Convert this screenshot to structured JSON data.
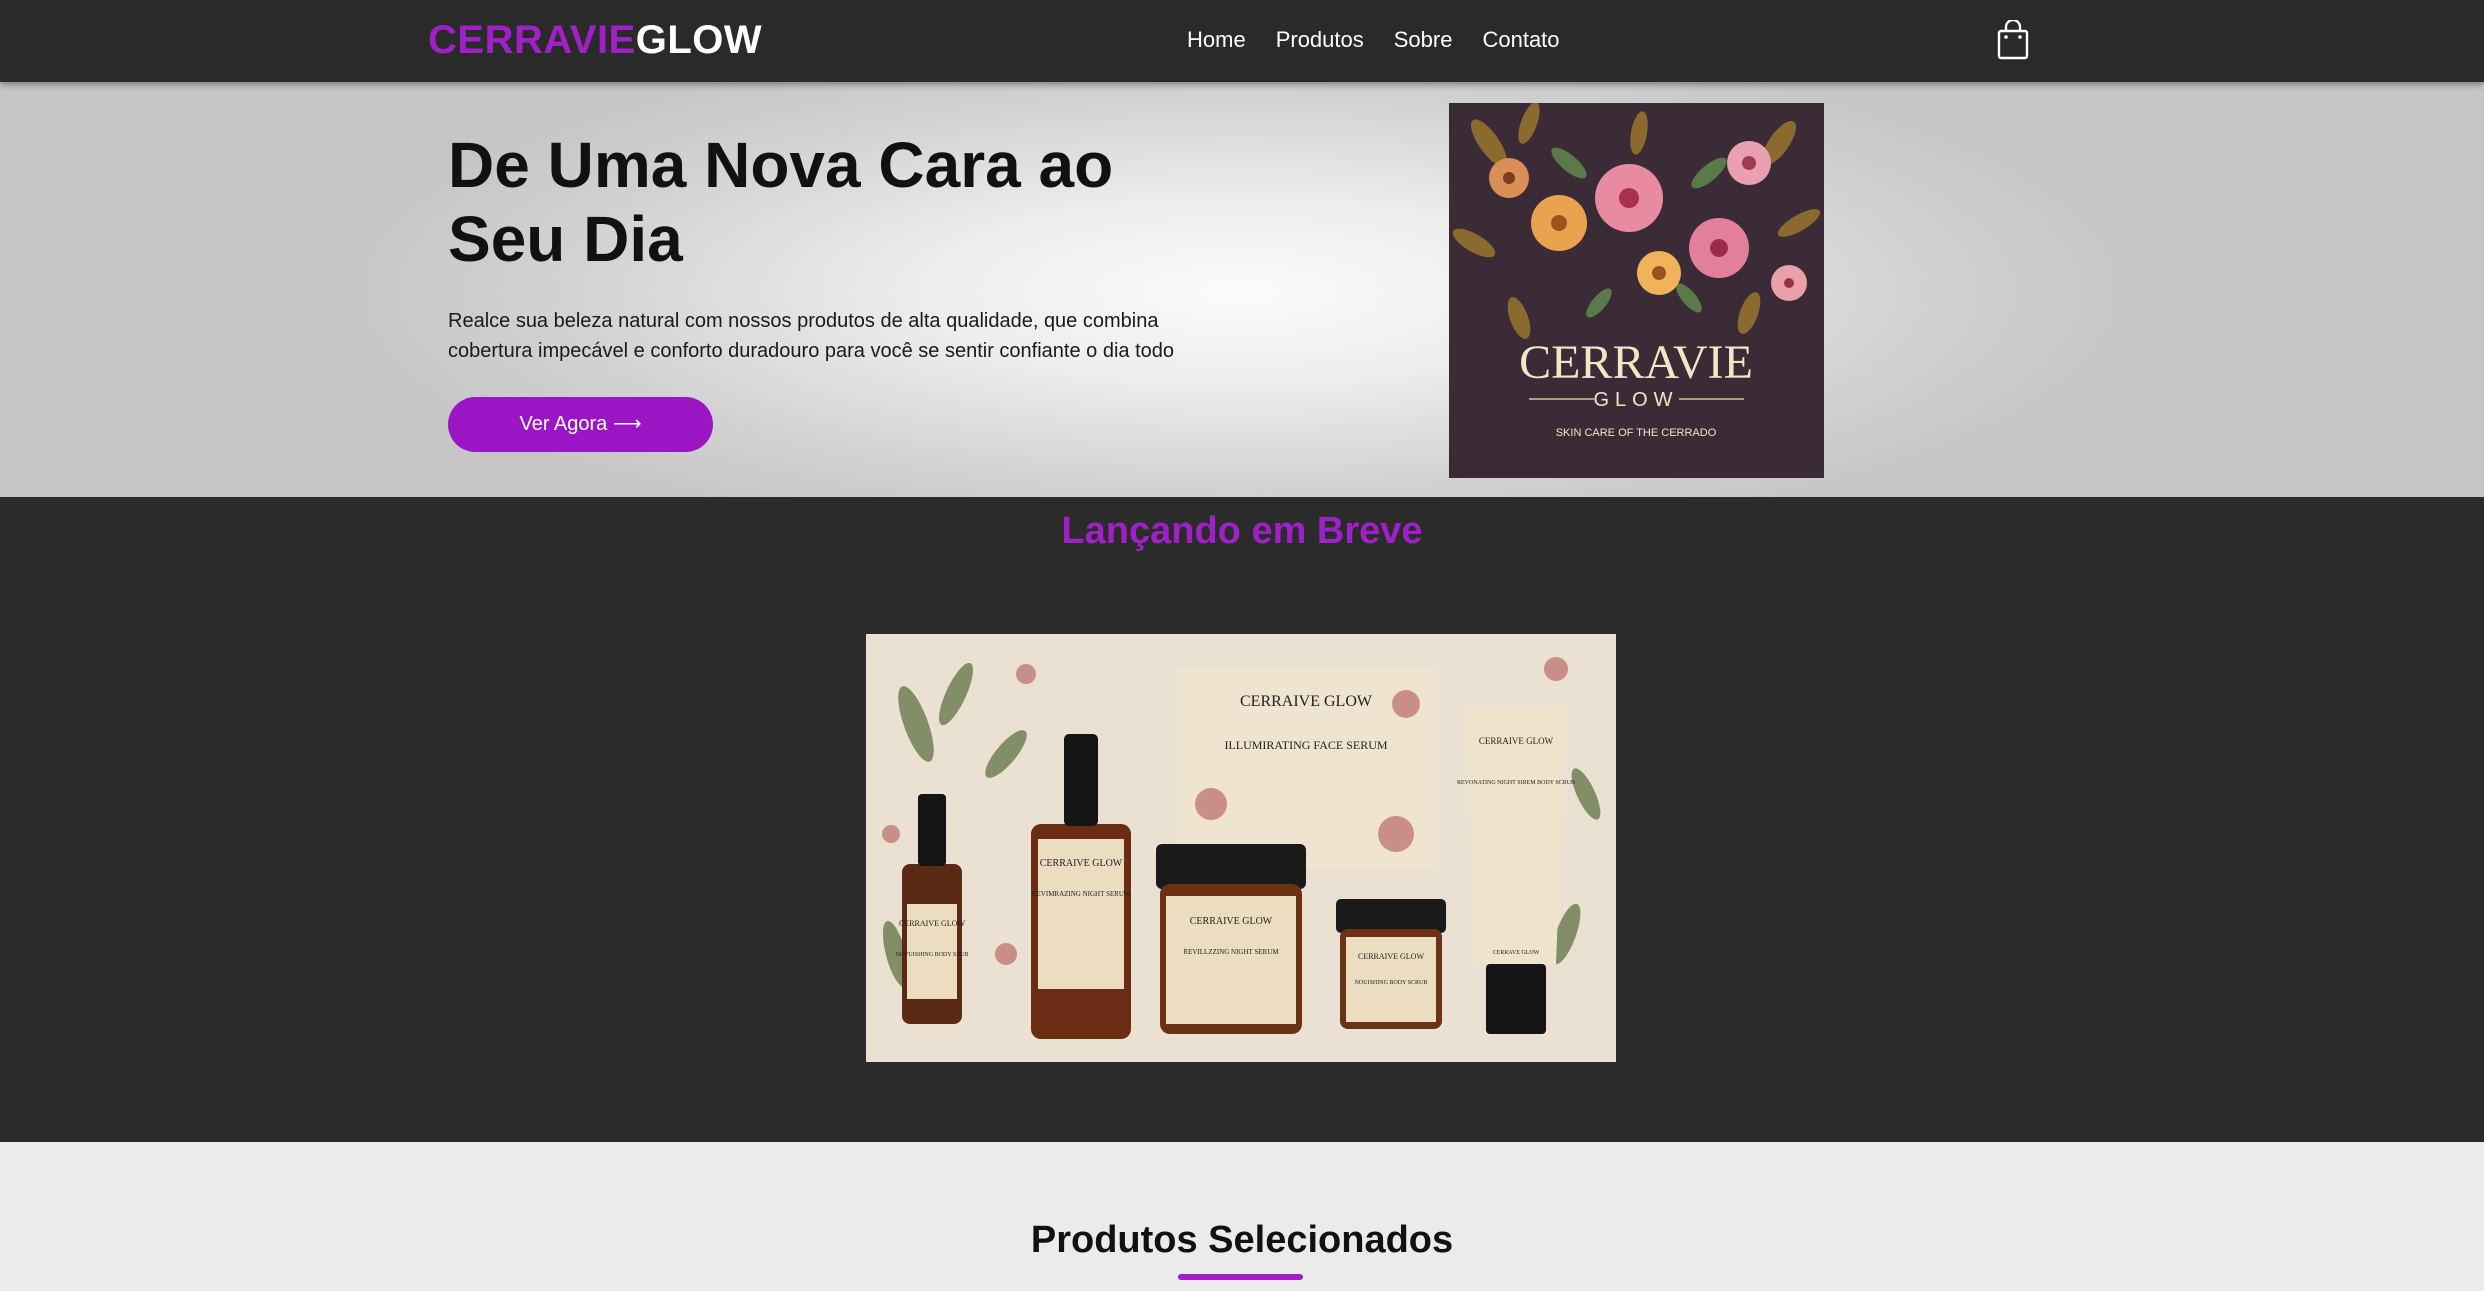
{
  "nav": {
    "logo_part1": "CERRAVIE",
    "logo_part2": "GLOW",
    "links": [
      "Home",
      "Produtos",
      "Sobre",
      "Contato"
    ],
    "cart_icon": "shopping-bag-icon"
  },
  "hero": {
    "title": "De Uma Nova Cara ao Seu Dia",
    "description": "Realce sua beleza natural com nossos produtos de alta qualidade, que combina cobertura impecável e conforto duradouro para você se sentir confiante o dia todo",
    "button_label": "Ver Agora ⟶",
    "brand_image": {
      "name": "CERRAVIE",
      "sub": "GLOW",
      "tagline": "SKIN CARE OF THE CERRADO"
    }
  },
  "launch": {
    "title": "Lançando em Breve",
    "packaging_labels": [
      "CERRAIVE GLOW",
      "ILLUMIRATING FACE SERUM",
      "REVIMRAZING NIGHT SERUM",
      "NOVUISHING BODY SRUB",
      "REVILLZZING NIGHT SERUM",
      "NOUISHING BODY SCRUB",
      "REVONATING NIGHT SIREM BODY SCRUB",
      "CERRAVE GLOW"
    ]
  },
  "selected": {
    "title": "Produtos Selecionados"
  },
  "colors": {
    "accent": "#a020c8",
    "nav_bg": "#2a2a2a",
    "dark_section": "#2b2b2b",
    "button": "#9a16c4"
  }
}
